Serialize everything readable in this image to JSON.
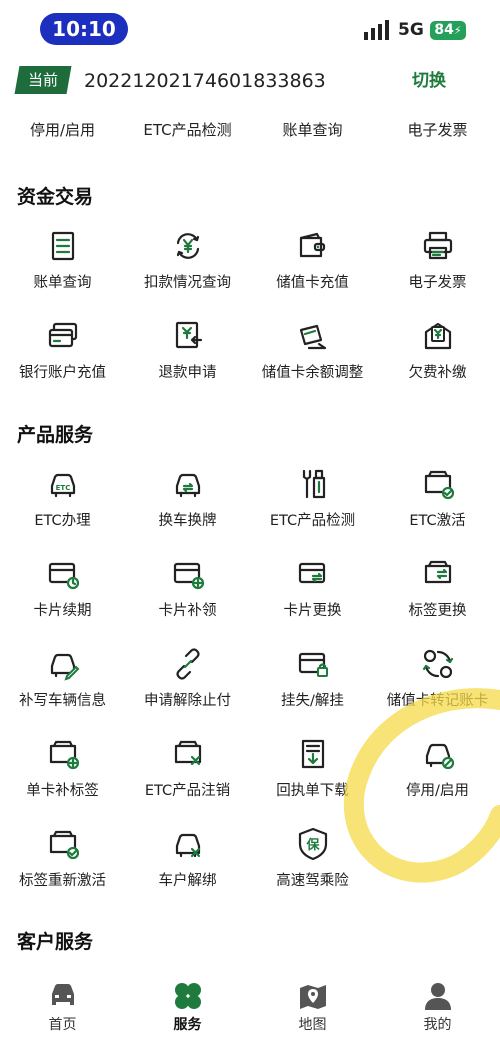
{
  "status_bar": {
    "time": "10:10",
    "network": "5G",
    "battery": "84"
  },
  "account": {
    "current_tag": "当前",
    "number": "20221202174601833863",
    "switch_label": "切换"
  },
  "quick_actions": [
    "停用/启用",
    "ETC产品检测",
    "账单查询",
    "电子发票"
  ],
  "sections": [
    {
      "title": "资金交易",
      "items": [
        {
          "label": "账单查询",
          "icon": "bill-icon"
        },
        {
          "label": "扣款情况查询",
          "icon": "yuan-refresh-icon"
        },
        {
          "label": "储值卡充值",
          "icon": "wallet-icon"
        },
        {
          "label": "电子发票",
          "icon": "printer-icon"
        },
        {
          "label": "银行账户充值",
          "icon": "bank-card-icon"
        },
        {
          "label": "退款申请",
          "icon": "refund-icon"
        },
        {
          "label": "储值卡余额调整",
          "icon": "card-adjust-icon"
        },
        {
          "label": "欠费补缴",
          "icon": "arrears-icon"
        }
      ]
    },
    {
      "title": "产品服务",
      "items": [
        {
          "label": "ETC办理",
          "icon": "etc-car-icon"
        },
        {
          "label": "换车换牌",
          "icon": "car-swap-icon"
        },
        {
          "label": "ETC产品检测",
          "icon": "tools-icon"
        },
        {
          "label": "ETC激活",
          "icon": "device-check-icon"
        },
        {
          "label": "卡片续期",
          "icon": "card-clock-icon"
        },
        {
          "label": "卡片补领",
          "icon": "card-plus-icon"
        },
        {
          "label": "卡片更换",
          "icon": "card-swap-icon"
        },
        {
          "label": "标签更换",
          "icon": "tag-swap-icon"
        },
        {
          "label": "补写车辆信息",
          "icon": "car-edit-icon"
        },
        {
          "label": "申请解除止付",
          "icon": "unlink-icon"
        },
        {
          "label": "挂失/解挂",
          "icon": "card-lock-icon"
        },
        {
          "label": "储值卡转记账卡",
          "icon": "card-convert-icon"
        },
        {
          "label": "单卡补标签",
          "icon": "device-plus-icon"
        },
        {
          "label": "ETC产品注销",
          "icon": "device-cancel-icon"
        },
        {
          "label": "回执单下载",
          "icon": "receipt-download-icon"
        },
        {
          "label": "停用/启用",
          "icon": "car-disable-icon"
        },
        {
          "label": "标签重新激活",
          "icon": "tag-reactivate-icon"
        },
        {
          "label": "车户解绑",
          "icon": "car-unbind-icon"
        },
        {
          "label": "高速驾乘险",
          "icon": "insurance-shield-icon"
        }
      ]
    }
  ],
  "customer_section_title": "客户服务",
  "bottom_nav": [
    {
      "label": "首页",
      "icon": "car-home-icon",
      "active": false
    },
    {
      "label": "服务",
      "icon": "clover-icon",
      "active": true
    },
    {
      "label": "地图",
      "icon": "map-icon",
      "active": false
    },
    {
      "label": "我的",
      "icon": "profile-icon",
      "active": false
    }
  ],
  "colors": {
    "accent": "#1e7a3d",
    "icon_dark": "#222222",
    "time_pill": "#1c2fbf",
    "battery": "#25a05a",
    "highlighter": "#f5d94a"
  }
}
